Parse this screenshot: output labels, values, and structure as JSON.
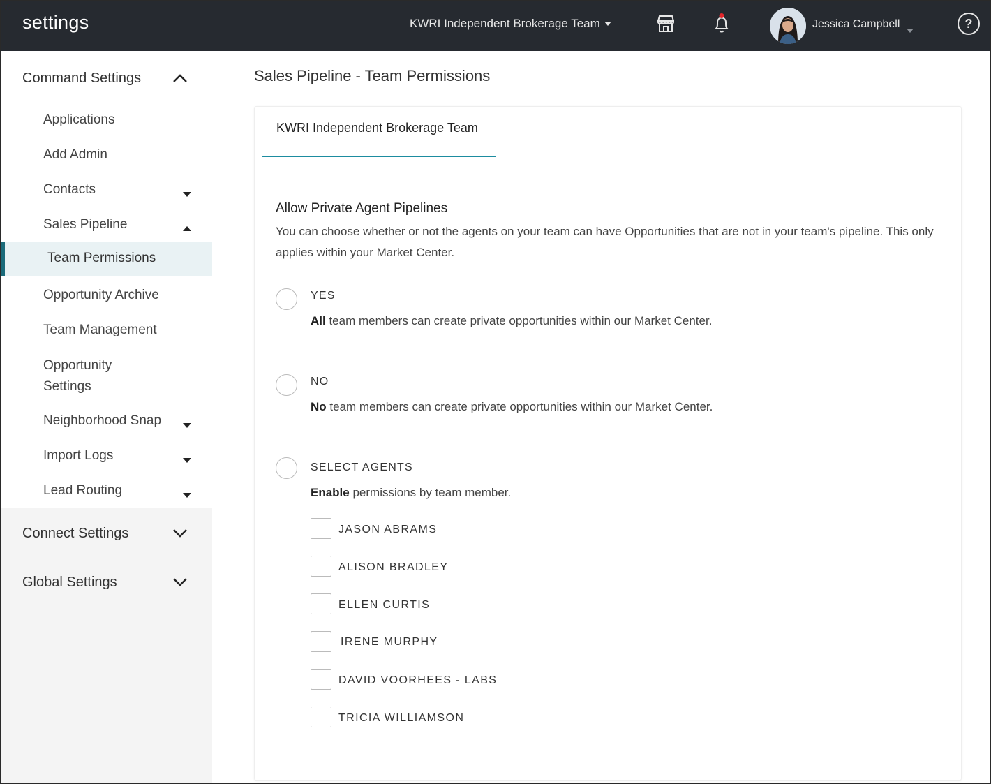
{
  "topbar": {
    "app_title": "settings",
    "team_select": "KWRI Independent Brokerage Team",
    "user_name": "Jessica Campbell",
    "help_glyph": "?",
    "icons": [
      "store-icon",
      "bell-icon",
      "help-icon"
    ]
  },
  "sidebar": {
    "command_settings": "Command Settings",
    "items": [
      {
        "label": "Applications"
      },
      {
        "label": "Add Admin"
      },
      {
        "label": "Contacts"
      },
      {
        "label": "Sales Pipeline"
      },
      {
        "label": "Team Permissions"
      },
      {
        "label": "Opportunity Archive"
      },
      {
        "label": "Team Management"
      },
      {
        "label": "Opportunity Settings"
      },
      {
        "label": "Neighborhood Snap"
      },
      {
        "label": "Import Logs"
      },
      {
        "label": "Lead Routing"
      }
    ],
    "connect_settings": "Connect Settings",
    "global_settings": "Global Settings"
  },
  "main": {
    "page_title": "Sales Pipeline - Team Permissions",
    "tab_label": "KWRI Independent Brokerage Team",
    "section_title": "Allow Private Agent Pipelines",
    "section_desc": "You can choose whether or not the agents on your team can have Opportunities that are not in your team's pipeline. This only applies within your Market Center.",
    "options": [
      {
        "label": "YES",
        "desc_bold": "All",
        "desc_rest": " team members can create private opportunities within our Market Center."
      },
      {
        "label": "NO",
        "desc_bold": "No",
        "desc_rest": " team members can create private opportunities within our Market Center."
      },
      {
        "label": "SELECT AGENTS",
        "desc_bold": "Enable",
        "desc_rest": " permissions by team member."
      }
    ],
    "agents": [
      "JASON ABRAMS",
      "ALISON BRADLEY",
      "ELLEN CURTIS",
      "IRENE MURPHY",
      "DAVID VOORHEES - LABS",
      "TRICIA WILLIAMSON"
    ]
  },
  "colors": {
    "topbar_bg": "#262a30",
    "accent": "#1d8ca0",
    "active_border": "#1b6b7a",
    "active_bg": "#e9f2f4",
    "notification_dot": "#e3262b"
  }
}
